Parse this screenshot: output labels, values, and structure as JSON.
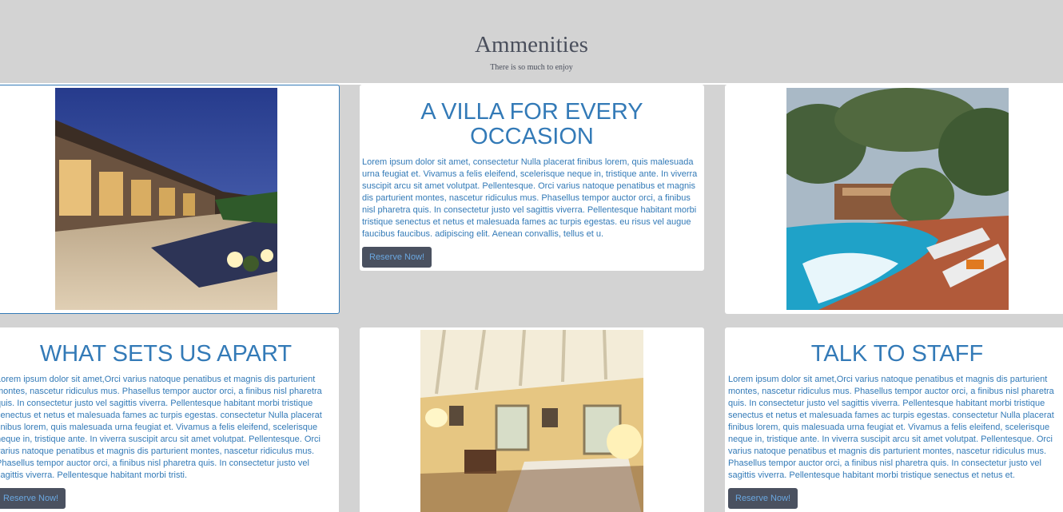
{
  "header": {
    "title": "Ammenities",
    "subtitle": "There is so much to enjoy"
  },
  "cards": {
    "villa": {
      "title": "A VILLA FOR EVERY OCCASION",
      "body": "Lorem ipsum dolor sit amet, consectetur Nulla placerat finibus lorem, quis malesuada urna feugiat et. Vivamus a felis eleifend, scelerisque neque in, tristique ante. In viverra suscipit arcu sit amet volutpat. Pellentesque. Orci varius natoque penatibus et magnis dis parturient montes, nascetur ridiculus mus. Phasellus tempor auctor orci, a finibus nisl pharetra quis. In consectetur justo vel sagittis viverra. Pellentesque habitant morbi tristique senectus et netus et malesuada fames ac turpis egestas. eu risus vel augue faucibus faucibus. adipiscing elit. Aenean convallis, tellus et u.",
      "button": "Reserve Now!"
    },
    "apart": {
      "title": "WHAT SETS US APART",
      "body": "Lorem ipsum dolor sit amet,Orci varius natoque penatibus et magnis dis parturient montes, nascetur ridiculus mus. Phasellus tempor auctor orci, a finibus nisl pharetra quis. In consectetur justo vel sagittis viverra. Pellentesque habitant morbi tristique senectus et netus et malesuada fames ac turpis egestas. consectetur Nulla placerat finibus lorem, quis malesuada urna feugiat et. Vivamus a felis eleifend, scelerisque neque in, tristique ante. In viverra suscipit arcu sit amet volutpat. Pellentesque. Orci varius natoque penatibus et magnis dis parturient montes, nascetur ridiculus mus. Phasellus tempor auctor orci, a finibus nisl pharetra quis. In consectetur justo vel sagittis viverra. Pellentesque habitant morbi tristi.",
      "button": "Reserve Now!"
    },
    "staff": {
      "title": "TALK TO STAFF",
      "body": "Lorem ipsum dolor sit amet,Orci varius natoque penatibus et magnis dis parturient montes, nascetur ridiculus mus. Phasellus tempor auctor orci, a finibus nisl pharetra quis. In consectetur justo vel sagittis viverra. Pellentesque habitant morbi tristique senectus et netus et malesuada fames ac turpis egestas. consectetur Nulla placerat finibus lorem, quis malesuada urna feugiat et. Vivamus a felis eleifend, scelerisque neque in, tristique ante. In viverra suscipit arcu sit amet volutpat. Pellentesque. Orci varius natoque penatibus et magnis dis parturient montes, nascetur ridiculus mus. Phasellus tempor auctor orci, a finibus nisl pharetra quis. In consectetur justo vel sagittis viverra. Pellentesque habitant morbi tristique senectus et netus et.",
      "button": "Reserve Now!"
    }
  },
  "colors": {
    "page_background": "#d3d3d3",
    "card_background": "#ffffff",
    "heading_blue": "#337ab7",
    "button_background": "#4a5160",
    "title_gray": "#4a4f5c"
  }
}
